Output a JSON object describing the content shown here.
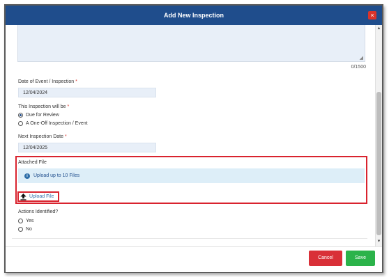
{
  "dialog": {
    "title": "Add New Inspection",
    "close_glyph": "×"
  },
  "description": {
    "char_count": "0/1500"
  },
  "date_of_event": {
    "label": "Date of Event / Inspection",
    "required_mark": "*",
    "value": "12/04/2024"
  },
  "inspection_type": {
    "label": "This Inspection will be",
    "required_mark": "*",
    "options": [
      {
        "label": "Due for Review",
        "selected": true
      },
      {
        "label": "A One-Off Inspection / Event",
        "selected": false
      }
    ]
  },
  "next_inspection": {
    "label": "Next Inspection Date",
    "required_mark": "*",
    "value": "12/04/2025"
  },
  "attached_file": {
    "label": "Attached File",
    "info_text": "Upload up to 10 Files",
    "upload_label": "Upload File",
    "info_icon_glyph": "i"
  },
  "actions_identified": {
    "label": "Actions Identified?",
    "options": [
      {
        "label": "Yes",
        "selected": false
      },
      {
        "label": "No",
        "selected": false
      }
    ]
  },
  "footer": {
    "cancel_label": "Cancel",
    "save_label": "Save"
  },
  "colors": {
    "header": "#1f4d8c",
    "cancel": "#d93038",
    "save": "#2bb34a",
    "highlight": "#d9232e"
  },
  "icons": {
    "close": "close-icon",
    "info": "info-icon",
    "upload": "upload-icon"
  }
}
